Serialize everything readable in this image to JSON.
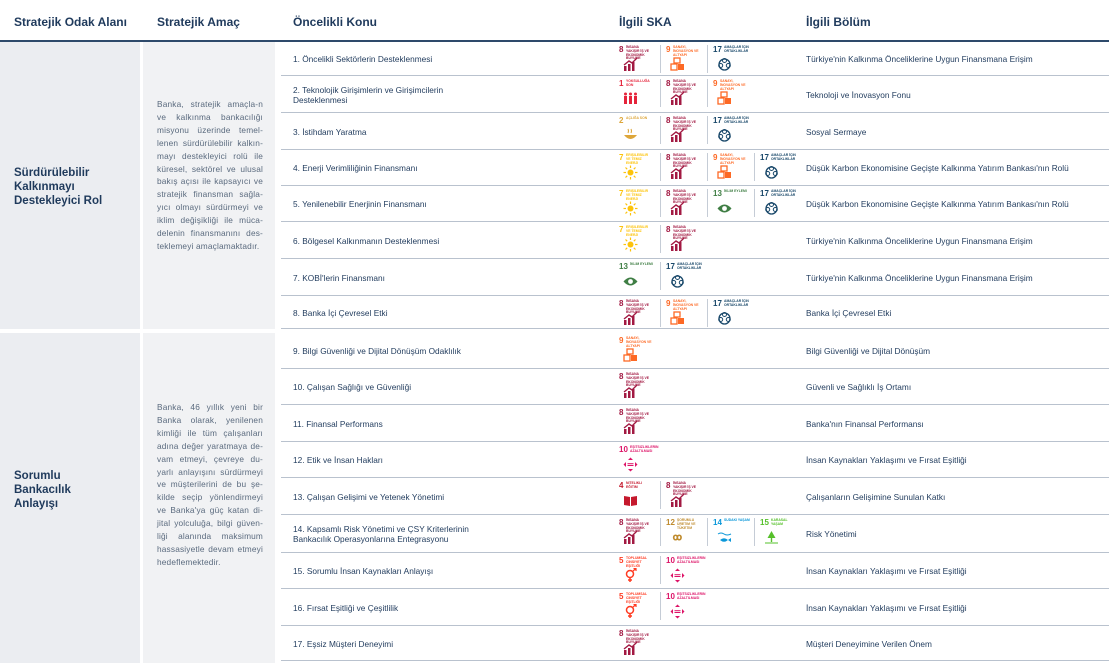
{
  "headers": {
    "area": "Stratejik Odak Alanı",
    "goal": "Stratejik Amaç",
    "topic": "Öncelikli Konu",
    "sdg": "İlgili SKA",
    "dept": "İlgili Bölüm"
  },
  "sections": [
    {
      "area": "Sürdürülebilir Kalkınmayı Destekleyici Rol",
      "goal": "Banka, stratejik amaçla-n ve kalkınma bankacılığı misyonu üzerinde temel-lenen sürdürülebilir kalkın-mayı destekleyici rolü ile küresel, sektörel ve ulusal bakış açısı ile kapsayıcı ve stratejik finansman sağla-yıcı olmayı sürdürmeyi ve iklim değişikliği ile müca-delenin finansmanını des-teklemeyi amaçlamaktadır."
    },
    {
      "area": "Sorumlu Bankacılık Anlayışı",
      "goal": "Banka, 46 yıllık yeni bir Banka olarak, yenilenen kimliği ile tüm çalışanları adına değer yaratmaya de-vam etmeyi, çevreye du-yarlı anlayışını sürdürmeyi ve müşterilerini de bu şe-kilde seçip yönlendirmeyi ve Banka'ya güç katan di-jital yolculuğa, bilgi güven-liği alanında maksimum hassasiyetle devam etmeyi hedeflemektedir."
    }
  ],
  "sdg_defs": {
    "1": {
      "label": "Yoksulluğa Son",
      "color": "#e5243b",
      "icon": "people-icon"
    },
    "2": {
      "label": "Açlığa Son",
      "color": "#dda63a",
      "icon": "bowl-icon"
    },
    "4": {
      "label": "Nitelikli Eğitim",
      "color": "#c5192d",
      "icon": "book-icon"
    },
    "5": {
      "label": "Toplumsal Cinsiyet Eşitliği",
      "color": "#ff3a21",
      "icon": "gender-icon"
    },
    "7": {
      "label": "Erişilebilir ve Temiz Enerji",
      "color": "#fcc30b",
      "icon": "sun-icon"
    },
    "8": {
      "label": "İnsana Yakışır İş ve Ekonomik Büyüme",
      "color": "#a21942",
      "icon": "growth-chart-icon"
    },
    "9": {
      "label": "Sanayi, İnovasyon ve Altyapı",
      "color": "#fd6925",
      "icon": "cubes-icon"
    },
    "10": {
      "label": "Eşitsizliklerin Azaltılması",
      "color": "#dd1367",
      "icon": "arrows-icon"
    },
    "12": {
      "label": "Sorumlu Üretim ve Tüketim",
      "color": "#bf8b2e",
      "icon": "infinity-icon"
    },
    "13": {
      "label": "İklim Eylemi",
      "color": "#3f7e44",
      "icon": "eye-icon"
    },
    "14": {
      "label": "Sudaki Yaşam",
      "color": "#0a97d9",
      "icon": "fish-icon"
    },
    "15": {
      "label": "Karasal Yaşam",
      "color": "#56c02b",
      "icon": "tree-icon"
    },
    "17": {
      "label": "Amaçlar İçin Ortaklıklar",
      "color": "#19486a",
      "icon": "ring-icon"
    }
  },
  "rows": [
    {
      "topic": "1. Öncelikli Sektörlerin Desteklenmesi",
      "sdgs": [
        8,
        9,
        17
      ],
      "dept": "Türkiye'nin Kalkınma Önceliklerine Uygun Finansmana Erişim"
    },
    {
      "topic": "2. Teknolojik Girişimlerin ve Girişimcilerin Desteklenmesi",
      "sdgs": [
        1,
        8,
        9
      ],
      "dept": "Teknoloji ve İnovasyon Fonu"
    },
    {
      "topic": "3. İstihdam Yaratma",
      "sdgs": [
        2,
        8,
        17
      ],
      "dept": "Sosyal Sermaye"
    },
    {
      "topic": "4. Enerji Verimliliğinin Finansmanı",
      "sdgs": [
        7,
        8,
        9,
        17
      ],
      "dept": "Düşük Karbon Ekonomisine Geçişte Kalkınma Yatırım Bankası'nın Rolü"
    },
    {
      "topic": "5. Yenilenebilir Enerjinin Finansmanı",
      "sdgs": [
        7,
        8,
        13,
        17
      ],
      "dept": "Düşük Karbon Ekonomisine Geçişte Kalkınma Yatırım Bankası'nın Rolü"
    },
    {
      "topic": "6. Bölgesel Kalkınmanın Desteklenmesi",
      "sdgs": [
        7,
        8
      ],
      "dept": "Türkiye'nin Kalkınma Önceliklerine Uygun Finansmana Erişim"
    },
    {
      "topic": "7. KOBİ'lerin Finansmanı",
      "sdgs": [
        13,
        17
      ],
      "dept": "Türkiye'nin Kalkınma Önceliklerine Uygun Finansmana Erişim"
    },
    {
      "topic": "8. Banka İçi Çevresel Etki",
      "sdgs": [
        8,
        9,
        17
      ],
      "dept": "Banka İçi Çevresel Etki"
    },
    {
      "topic": "9. Bilgi Güvenliği ve Dijital Dönüşüm Odaklılık",
      "sdgs": [
        9
      ],
      "dept": "Bilgi Güvenliği ve Dijital Dönüşüm"
    },
    {
      "topic": "10. Çalışan Sağlığı ve Güvenliği",
      "sdgs": [
        8
      ],
      "dept": "Güvenli ve Sağlıklı İş Ortamı"
    },
    {
      "topic": "11. Finansal Performans",
      "sdgs": [
        8
      ],
      "dept": "Banka'nın Finansal Performansı"
    },
    {
      "topic": "12. Etik ve İnsan Hakları",
      "sdgs": [
        10
      ],
      "dept": "İnsan Kaynakları Yaklaşımı ve Fırsat Eşitliği"
    },
    {
      "topic": "13. Çalışan Gelişimi ve Yetenek Yönetimi",
      "sdgs": [
        4,
        8
      ],
      "dept": "Çalışanların Gelişimine Sunulan Katkı"
    },
    {
      "topic": "14. Kapsamlı Risk Yönetimi ve ÇSY Kriterlerinin Bankacılık Operasyonlarına Entegrasyonu",
      "sdgs": [
        8,
        12,
        14,
        15
      ],
      "dept": "Risk Yönetimi"
    },
    {
      "topic": "15. Sorumlu İnsan Kaynakları Anlayışı",
      "sdgs": [
        5,
        10
      ],
      "dept": "İnsan Kaynakları Yaklaşımı ve Fırsat Eşitliği"
    },
    {
      "topic": "16. Fırsat Eşitliği ve Çeşitlilik",
      "sdgs": [
        5,
        10
      ],
      "dept": "İnsan Kaynakları Yaklaşımı ve Fırsat Eşitliği"
    },
    {
      "topic": "17. Eşsiz Müşteri Deneyimi",
      "sdgs": [
        8
      ],
      "dept": "Müşteri Deneyimine Verilen Önem"
    }
  ]
}
